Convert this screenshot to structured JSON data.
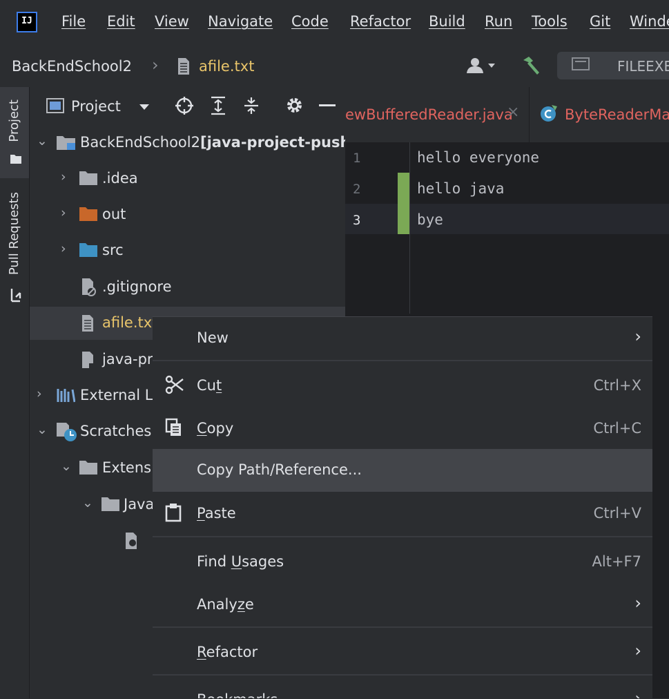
{
  "menubar": {
    "logo": "IJ",
    "items": [
      "File",
      "Edit",
      "View",
      "Navigate",
      "Code",
      "Refactor",
      "Build",
      "Run",
      "Tools",
      "Git",
      "Winde"
    ]
  },
  "navbar": {
    "project": "BackEndSchool2",
    "file": "afile.txt",
    "run_config": "FILEEXE"
  },
  "tool_strip": {
    "project": "Project",
    "pull_requests": "Pull Requests"
  },
  "project_panel": {
    "title": "Project",
    "root_name": "BackEndSchool2",
    "root_suffix": "[java-project-push-",
    "items": [
      ".idea",
      "out",
      "src",
      ".gitignore",
      "afile.txt",
      "java-pr",
      "External Li",
      "Scratches",
      "Extensi",
      "Java"
    ]
  },
  "editor": {
    "tabs": [
      "ewBufferedReader.java",
      "ByteReaderMai"
    ],
    "line_numbers": [
      "1",
      "2",
      "3"
    ],
    "lines": [
      "hello everyone",
      "hello java",
      "bye"
    ]
  },
  "context_menu": {
    "new": "New",
    "cut_pre": "Cu",
    "cut_u": "t",
    "cut_shortcut": "Ctrl+X",
    "copy_u": "C",
    "copy_post": "opy",
    "copy_shortcut": "Ctrl+C",
    "copy_path": "Copy Path/Reference...",
    "paste_u": "P",
    "paste_post": "aste",
    "paste_shortcut": "Ctrl+V",
    "find_pre": "Find ",
    "find_u": "U",
    "find_post": "sages",
    "find_shortcut": "Alt+F7",
    "analyze_pre": "Analy",
    "analyze_u": "z",
    "analyze_post": "e",
    "refactor_u": "R",
    "refactor_post": "efactor",
    "bookmarks": "Bookmarks"
  },
  "colors": {
    "accent_blue": "#3d7dea",
    "file_yellow": "#e8c46a",
    "tab_red": "#e0645f",
    "vcs_green": "#7ba955"
  }
}
